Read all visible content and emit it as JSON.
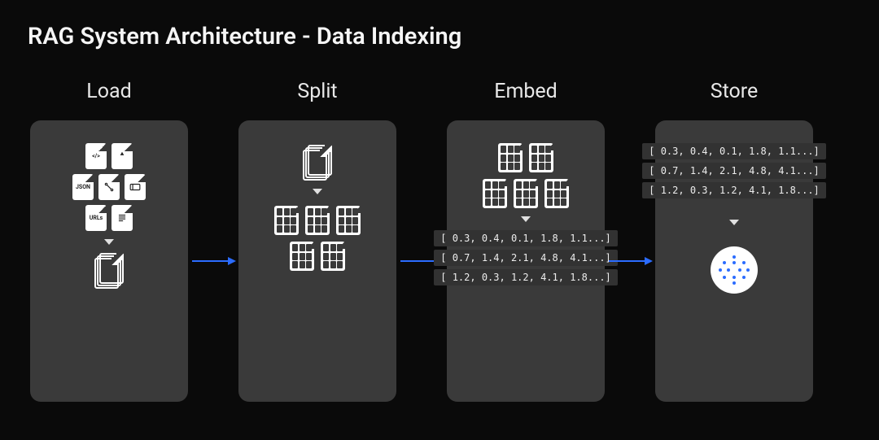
{
  "title": "RAG System Architecture - Data Indexing",
  "steps": {
    "load": {
      "label": "Load"
    },
    "split": {
      "label": "Split"
    },
    "embed": {
      "label": "Embed"
    },
    "store": {
      "label": "Store"
    }
  },
  "file_badges": {
    "code": "</>",
    "pdf": "",
    "json": "JSON",
    "sketch": "",
    "db": "",
    "urls": "URLs",
    "lines": ""
  },
  "vectors": [
    "[ 0.3, 0.4, 0.1, 1.8, 1.1...]",
    "[ 0.7, 1.4, 2.1, 4.8, 4.1...]",
    "[ 1.2, 0.3, 1.2, 4.1, 1.8...]"
  ],
  "accent_arrow_color": "#2b6cff"
}
